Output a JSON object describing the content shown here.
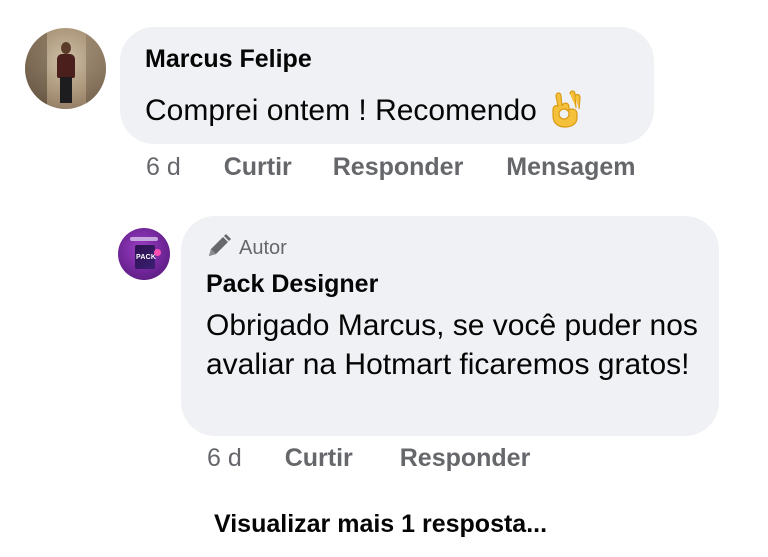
{
  "comment": {
    "author": "Marcus Felipe",
    "text": "Comprei ontem ! Recomendo",
    "emoji_icon": "ok-hand-emoji-icon",
    "time": "6 d",
    "actions": {
      "like": "Curtir",
      "reply": "Responder",
      "message": "Mensagem"
    }
  },
  "reply": {
    "badge": "Autor",
    "badge_icon": "pencil-icon",
    "author": "Pack Designer",
    "text": "Obrigado Marcus, se você puder nos avaliar na Hotmart ficaremos gratos!",
    "time": "6 d",
    "actions": {
      "like": "Curtir",
      "reply": "Responder"
    }
  },
  "view_more": "Visualizar mais 1 resposta...",
  "colors": {
    "bubble": "#eff1f4",
    "secondary_text": "#65676b",
    "primary_text": "#050505"
  }
}
